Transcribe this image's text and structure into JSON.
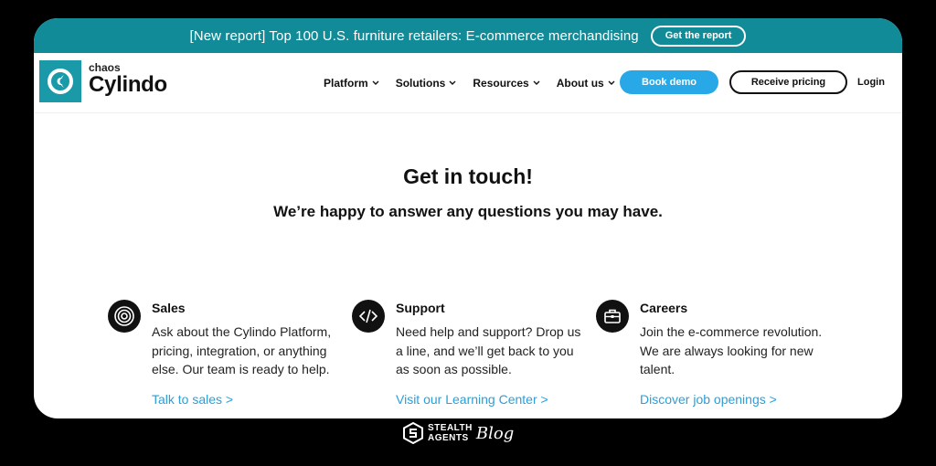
{
  "banner": {
    "text": "[New report] Top 100 U.S. furniture retailers: E-commerce merchandising",
    "button": "Get the report"
  },
  "logo": {
    "small": "chaos",
    "big": "Cylindo"
  },
  "nav": {
    "items": [
      {
        "label": "Platform"
      },
      {
        "label": "Solutions"
      },
      {
        "label": "Resources"
      },
      {
        "label": "About us"
      }
    ],
    "book_demo": "Book demo",
    "receive_pricing": "Receive pricing",
    "login": "Login"
  },
  "hero": {
    "title": "Get in touch!",
    "subtitle": "We’re happy to answer any questions you may have."
  },
  "cards": [
    {
      "icon": "target-icon",
      "title": "Sales",
      "desc": "Ask about the Cylindo Platform, pricing, integration, or anything else. Our team is ready to help.",
      "link": "Talk to sales >"
    },
    {
      "icon": "code-icon",
      "title": "Support",
      "desc": "Need help and support? Drop us a line, and we’ll get back to you as soon as possible.",
      "link": "Visit our Learning Center >"
    },
    {
      "icon": "briefcase-icon",
      "title": "Careers",
      "desc": "Join the e-commerce revolution. We are always looking for new talent.",
      "link": "Discover job openings >"
    }
  ],
  "watermark": {
    "line1": "STEALTH",
    "line2": "AGENTS",
    "script": "Blog"
  },
  "colors": {
    "banner": "#128b98",
    "accent": "#29a8e8",
    "link": "#2a9fd8",
    "logo": "#1a9aa8"
  }
}
